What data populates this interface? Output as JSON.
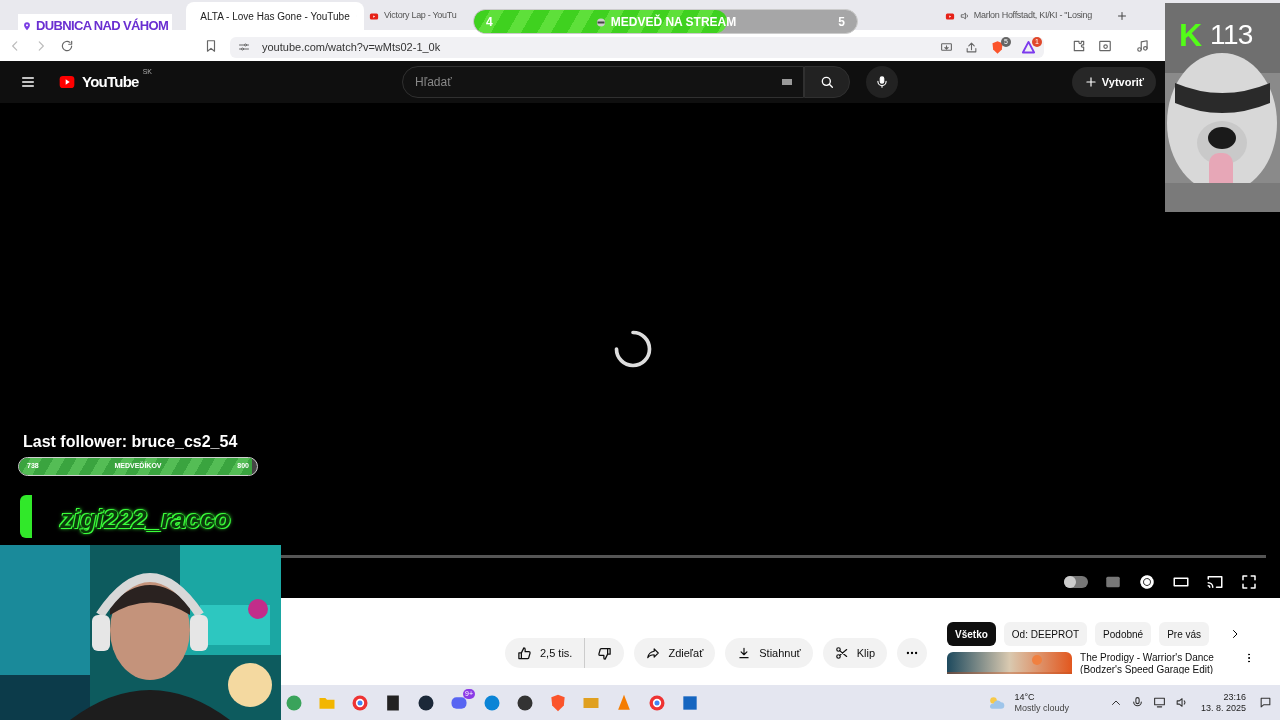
{
  "browser": {
    "tabs": [
      {
        "title": "ALTA - Love Has Gone - YouTube",
        "selected": true,
        "audio": false
      },
      {
        "title": "Victory Lap - YouTu",
        "selected": false,
        "audio": false
      },
      {
        "title": "Marlon Hoffstadt, KI/KI - \"Losing",
        "selected": false,
        "audio": true
      }
    ],
    "url": "youtube.com/watch?v=wMts02-1_0k",
    "shield_badge": "5",
    "rewards_badge": "1"
  },
  "youtube": {
    "logo": "YouTube",
    "region": "SK",
    "search_placeholder": "Hľadať",
    "create": "Vytvoriť"
  },
  "player": {
    "autoplay_on": false
  },
  "actions": {
    "likes": "2,5 tis.",
    "share": "Zdieľať",
    "download": "Stiahnuť",
    "clip": "Klip"
  },
  "chips": [
    {
      "label": "Všetko",
      "selected": true
    },
    {
      "label": "Od: DEEPROT",
      "selected": false
    },
    {
      "label": "Podobné",
      "selected": false
    },
    {
      "label": "Pre vás",
      "selected": false
    }
  ],
  "recommended": [
    {
      "title": "The Prodigy - Warrior's Dance",
      "subtitle": "(Bodzer's Speed Garage Edit)"
    }
  ],
  "overlay": {
    "location": "DUBNICA NAD VÁHOM",
    "goal": {
      "current": "4",
      "label": "MEDVEĎ NA STREAM",
      "target": "5",
      "level": 0.66
    },
    "kick": {
      "logo": "K",
      "count": "113"
    },
    "last_follower": "Last follower: bruce_cs2_54",
    "follower_goal": {
      "current": "738",
      "label": "MEDVEĎÍKOV",
      "target": "800",
      "level": 0.98
    },
    "latest": "zigi222_racco"
  },
  "taskbar": {
    "temperature": "14°C",
    "weather": "Mostly cloudy",
    "time": "23:16",
    "date": "13. 8. 2025",
    "discord_badge": "9+"
  }
}
